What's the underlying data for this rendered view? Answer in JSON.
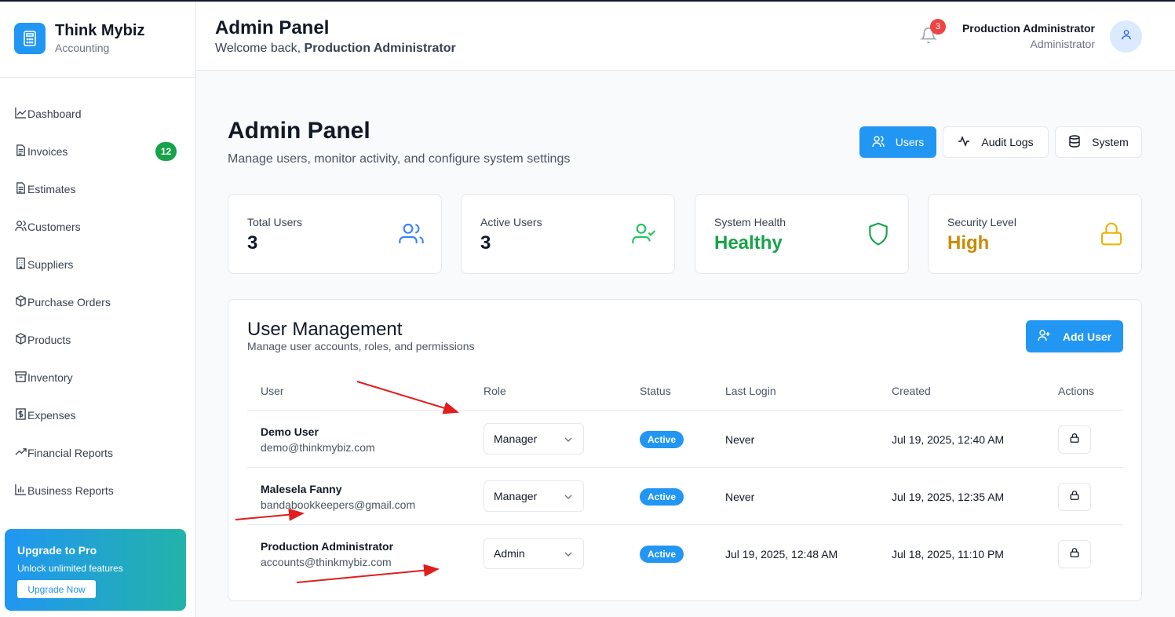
{
  "brand": {
    "name": "Think Mybiz",
    "subtitle": "Accounting"
  },
  "sidebar": {
    "items": [
      {
        "label": "Dashboard",
        "icon": "chart-line-icon"
      },
      {
        "label": "Invoices",
        "icon": "file-icon",
        "badge": "12"
      },
      {
        "label": "Estimates",
        "icon": "file-icon"
      },
      {
        "label": "Customers",
        "icon": "users-icon"
      },
      {
        "label": "Suppliers",
        "icon": "building-icon"
      },
      {
        "label": "Purchase Orders",
        "icon": "package-icon"
      },
      {
        "label": "Products",
        "icon": "package-icon"
      },
      {
        "label": "Inventory",
        "icon": "archive-icon"
      },
      {
        "label": "Expenses",
        "icon": "receipt-icon"
      },
      {
        "label": "Financial Reports",
        "icon": "trending-up-icon"
      },
      {
        "label": "Business Reports",
        "icon": "bar-chart-icon"
      }
    ],
    "upgrade": {
      "title": "Upgrade to Pro",
      "subtitle": "Unlock unlimited features",
      "button": "Upgrade Now"
    }
  },
  "header": {
    "title": "Admin Panel",
    "welcome_prefix": "Welcome back,",
    "welcome_name": "Production Administrator",
    "notification_count": "3",
    "user_name": "Production Administrator",
    "user_role": "Administrator"
  },
  "page": {
    "title": "Admin Panel",
    "subtitle": "Manage users, monitor activity, and configure system settings",
    "tabs": [
      {
        "label": "Users",
        "active": true
      },
      {
        "label": "Audit Logs",
        "active": false
      },
      {
        "label": "System",
        "active": false
      }
    ]
  },
  "stats": [
    {
      "label": "Total Users",
      "value": "3",
      "color": "#111827",
      "icon": "users-icon"
    },
    {
      "label": "Active Users",
      "value": "3",
      "color": "#111827",
      "icon": "user-check-icon"
    },
    {
      "label": "System Health",
      "value": "Healthy",
      "color": "#16a34a",
      "icon": "shield-icon"
    },
    {
      "label": "Security Level",
      "value": "High",
      "color": "#ca8a04",
      "icon": "lock-icon"
    }
  ],
  "user_management": {
    "title": "User Management",
    "subtitle": "Manage user accounts, roles, and permissions",
    "add_button": "Add User",
    "columns": [
      "User",
      "Role",
      "Status",
      "Last Login",
      "Created",
      "Actions"
    ],
    "rows": [
      {
        "name": "Demo User",
        "email": "demo@thinkmybiz.com",
        "role": "Manager",
        "status": "Active",
        "last_login": "Never",
        "created": "Jul 19, 2025, 12:40 AM"
      },
      {
        "name": "Malesela Fanny",
        "email": "bandabookkeepers@gmail.com",
        "role": "Manager",
        "status": "Active",
        "last_login": "Never",
        "created": "Jul 19, 2025, 12:35 AM"
      },
      {
        "name": "Production Administrator",
        "email": "accounts@thinkmybiz.com",
        "role": "Admin",
        "status": "Active",
        "last_login": "Jul 19, 2025, 12:48 AM",
        "created": "Jul 18, 2025, 11:10 PM"
      }
    ]
  },
  "colors": {
    "accent": "#2196f3",
    "success": "#16a34a",
    "warning": "#ca8a04",
    "danger": "#ef4444",
    "annotation": "#e11d1d"
  }
}
